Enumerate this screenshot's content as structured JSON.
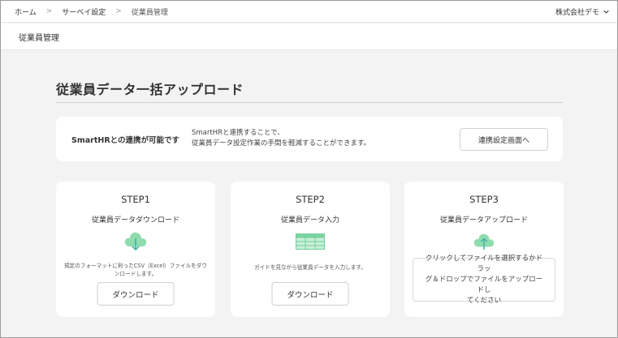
{
  "breadcrumb": {
    "items": [
      "ホーム",
      "サーベイ設定",
      "従業員管理"
    ],
    "separator": ">"
  },
  "company": {
    "name": "株式会社デモ"
  },
  "page_title": "従業員管理",
  "main": {
    "heading": "従業員データ一括アップロード",
    "integration": {
      "label": "SmartHRとの連携が可能です",
      "description_line1": "SmartHRと連携することで、",
      "description_line2": "従業員データ設定作業の手間を軽減することができます。",
      "button_label": "連携設定画面へ"
    },
    "steps": [
      {
        "title": "STEP1",
        "subtitle": "従業員データダウンロード",
        "icon": "cloud-download-icon",
        "description_line1": "規定のフォーマットに則ったCSV（Excel）ファイルをダウ",
        "description_line2": "ンロードします。",
        "button_label": "ダウンロード"
      },
      {
        "title": "STEP2",
        "subtitle": "従業員データ入力",
        "icon": "spreadsheet-icon",
        "description_line1": "ガイドを見ながら従業員データを入力します。",
        "button_label": "ダウンロード"
      },
      {
        "title": "STEP3",
        "subtitle": "従業員データアップロード",
        "icon": "cloud-upload-icon",
        "dropzone_line1": "クリックしてファイルを選択するかドラッ",
        "dropzone_line2": "グ＆ドロップでファイルをアップロードし",
        "dropzone_line3": "てください"
      }
    ]
  },
  "colors": {
    "accent_green": "#7fd3a3",
    "accent_teal": "#3fb3a4",
    "background": "#f3f3f3"
  }
}
